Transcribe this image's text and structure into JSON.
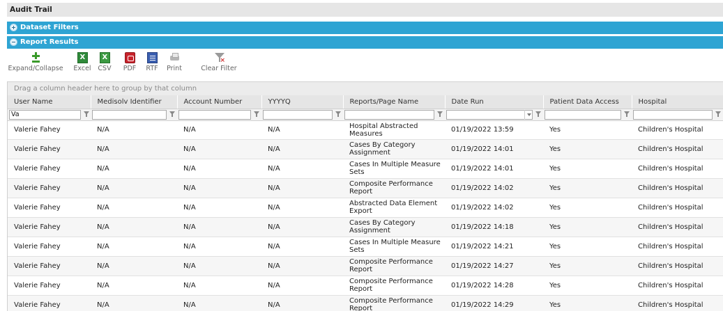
{
  "page": {
    "title": "Audit Trail"
  },
  "panels": {
    "filters_label": "Dataset Filters",
    "results_label": "Report Results"
  },
  "toolbar": {
    "expand_collapse": "Expand/Collapse",
    "excel": "Excel",
    "csv": "CSV",
    "pdf": "PDF",
    "rtf": "RTF",
    "print": "Print",
    "clear_filter": "Clear Filter"
  },
  "grid": {
    "group_hint": "Drag a column header here to group by that column",
    "columns": [
      "User Name",
      "Medisolv Identifier",
      "Account Number",
      "YYYYQ",
      "Reports/Page Name",
      "Date Run",
      "Patient Data Access",
      "Hospital"
    ],
    "filters": {
      "user_name": "Va"
    },
    "rows": [
      [
        "Valerie Fahey",
        "N/A",
        "N/A",
        "N/A",
        "Hospital Abstracted Measures",
        "01/19/2022 13:59",
        "Yes",
        "Children's Hospital"
      ],
      [
        "Valerie Fahey",
        "N/A",
        "N/A",
        "N/A",
        "Cases By Category Assignment",
        "01/19/2022 14:01",
        "Yes",
        "Children's Hospital"
      ],
      [
        "Valerie Fahey",
        "N/A",
        "N/A",
        "N/A",
        "Cases In Multiple Measure Sets",
        "01/19/2022 14:01",
        "Yes",
        "Children's Hospital"
      ],
      [
        "Valerie Fahey",
        "N/A",
        "N/A",
        "N/A",
        "Composite Performance Report",
        "01/19/2022 14:02",
        "Yes",
        "Children's Hospital"
      ],
      [
        "Valerie Fahey",
        "N/A",
        "N/A",
        "N/A",
        "Abstracted Data Element Export",
        "01/19/2022 14:02",
        "Yes",
        "Children's Hospital"
      ],
      [
        "Valerie Fahey",
        "N/A",
        "N/A",
        "N/A",
        "Cases By Category Assignment",
        "01/19/2022 14:18",
        "Yes",
        "Children's Hospital"
      ],
      [
        "Valerie Fahey",
        "N/A",
        "N/A",
        "N/A",
        "Cases In Multiple Measure Sets",
        "01/19/2022 14:21",
        "Yes",
        "Children's Hospital"
      ],
      [
        "Valerie Fahey",
        "N/A",
        "N/A",
        "N/A",
        "Composite Performance Report",
        "01/19/2022 14:27",
        "Yes",
        "Children's Hospital"
      ],
      [
        "Valerie Fahey",
        "N/A",
        "N/A",
        "N/A",
        "Composite Performance Report",
        "01/19/2022 14:28",
        "Yes",
        "Children's Hospital"
      ],
      [
        "Valerie Fahey",
        "N/A",
        "N/A",
        "N/A",
        "Composite Performance Report",
        "01/19/2022 14:29",
        "Yes",
        "Children's Hospital"
      ]
    ]
  },
  "colors": {
    "panel_bar": "#2ea4d3",
    "header_bg": "#e6e6e6",
    "pdf_red": "#c8232c",
    "excel_green": "#2f8a3a"
  },
  "icons": [
    "expand-collapse-icon",
    "excel-icon",
    "csv-icon",
    "pdf-icon",
    "rtf-icon",
    "print-icon",
    "clear-filter-icon",
    "filter-icon",
    "dropdown-icon"
  ]
}
